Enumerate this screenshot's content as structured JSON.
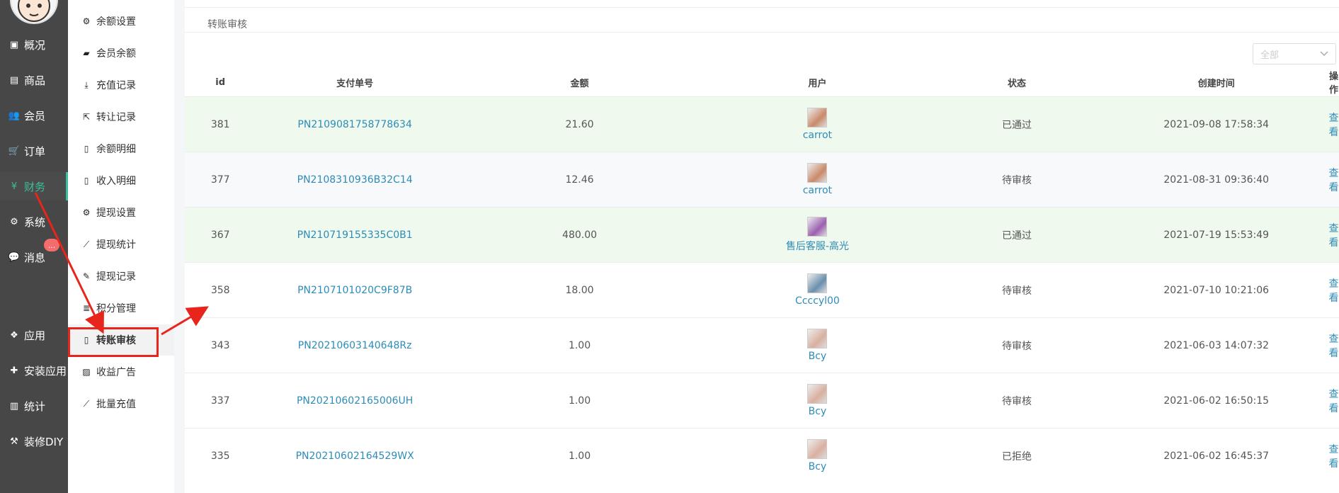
{
  "sidebar": {
    "items": [
      {
        "label": "概况",
        "icon": "dashboard-icon"
      },
      {
        "label": "商品",
        "icon": "box-icon"
      },
      {
        "label": "会员",
        "icon": "users-icon"
      },
      {
        "label": "订单",
        "icon": "cart-icon"
      },
      {
        "label": "财务",
        "icon": "yen-icon",
        "active": true
      },
      {
        "label": "系统",
        "icon": "gears-icon"
      },
      {
        "label": "消息",
        "icon": "chat-icon"
      },
      {
        "label": "应用",
        "icon": "cubes-icon"
      },
      {
        "label": "安装应用",
        "icon": "puzzle-icon"
      },
      {
        "label": "统计",
        "icon": "bar-chart-icon"
      },
      {
        "label": "装修DIY",
        "icon": "hammer-icon"
      }
    ],
    "badge": "..."
  },
  "submenu": {
    "items": [
      {
        "label": "余额设置",
        "icon": "gear-icon"
      },
      {
        "label": "会员余额",
        "icon": "book-icon"
      },
      {
        "label": "充值记录",
        "icon": "download-icon"
      },
      {
        "label": "转让记录",
        "icon": "external-link-icon"
      },
      {
        "label": "余额明细",
        "icon": "file-icon"
      },
      {
        "label": "收入明细",
        "icon": "file-icon"
      },
      {
        "label": "提现设置",
        "icon": "gear-icon"
      },
      {
        "label": "提现统计",
        "icon": "line-chart-icon"
      },
      {
        "label": "提现记录",
        "icon": "pencil-icon"
      },
      {
        "label": "积分管理",
        "icon": "database-icon"
      },
      {
        "label": "转账审核",
        "icon": "file-icon",
        "active": true
      },
      {
        "label": "收益广告",
        "icon": "image-icon"
      },
      {
        "label": "批量充值",
        "icon": "line-chart-icon"
      }
    ]
  },
  "breadcrumb": "转账审核",
  "filter": {
    "value": "全部"
  },
  "table": {
    "headers": [
      "id",
      "支付单号",
      "金额",
      "用户",
      "状态",
      "创建时间",
      "操作"
    ],
    "rows": [
      {
        "id": "381",
        "order": "PN2109081758778634",
        "amount": "21.60",
        "user": "carrot",
        "status": "已通过",
        "time": "2021-09-08 17:58:34",
        "action": "查看",
        "avatar": "#c98a6a"
      },
      {
        "id": "377",
        "order": "PN2108310936B32C14",
        "amount": "12.46",
        "user": "carrot",
        "status": "待审核",
        "time": "2021-08-31 09:36:40",
        "action": "查看",
        "avatar": "#c98a6a"
      },
      {
        "id": "367",
        "order": "PN210719155335C0B1",
        "amount": "480.00",
        "user": "售后客服-高光",
        "status": "已通过",
        "time": "2021-07-19 15:53:49",
        "action": "查看",
        "avatar": "#9a5fb0"
      },
      {
        "id": "358",
        "order": "PN2107101020C9F87B",
        "amount": "18.00",
        "user": "Ccccyl00",
        "status": "待审核",
        "time": "2021-07-10 10:21:06",
        "action": "查看",
        "avatar": "#6a8fae"
      },
      {
        "id": "343",
        "order": "PN20210603140648Rz",
        "amount": "1.00",
        "user": "Bcy",
        "status": "待审核",
        "time": "2021-06-03 14:07:32",
        "action": "查看",
        "avatar": "#d9b0a0"
      },
      {
        "id": "337",
        "order": "PN20210602165006UH",
        "amount": "1.00",
        "user": "Bcy",
        "status": "待审核",
        "time": "2021-06-02 16:50:15",
        "action": "查看",
        "avatar": "#d9b0a0"
      },
      {
        "id": "335",
        "order": "PN20210602164529WX",
        "amount": "1.00",
        "user": "Bcy",
        "status": "已拒绝",
        "time": "2021-06-02 16:45:37",
        "action": "查看",
        "avatar": "#d9b0a0"
      }
    ]
  },
  "colors": {
    "accent": "#3bbf9a",
    "link": "#2d8cb8",
    "annotation": "#e8251c",
    "sidebar": "#474747"
  }
}
